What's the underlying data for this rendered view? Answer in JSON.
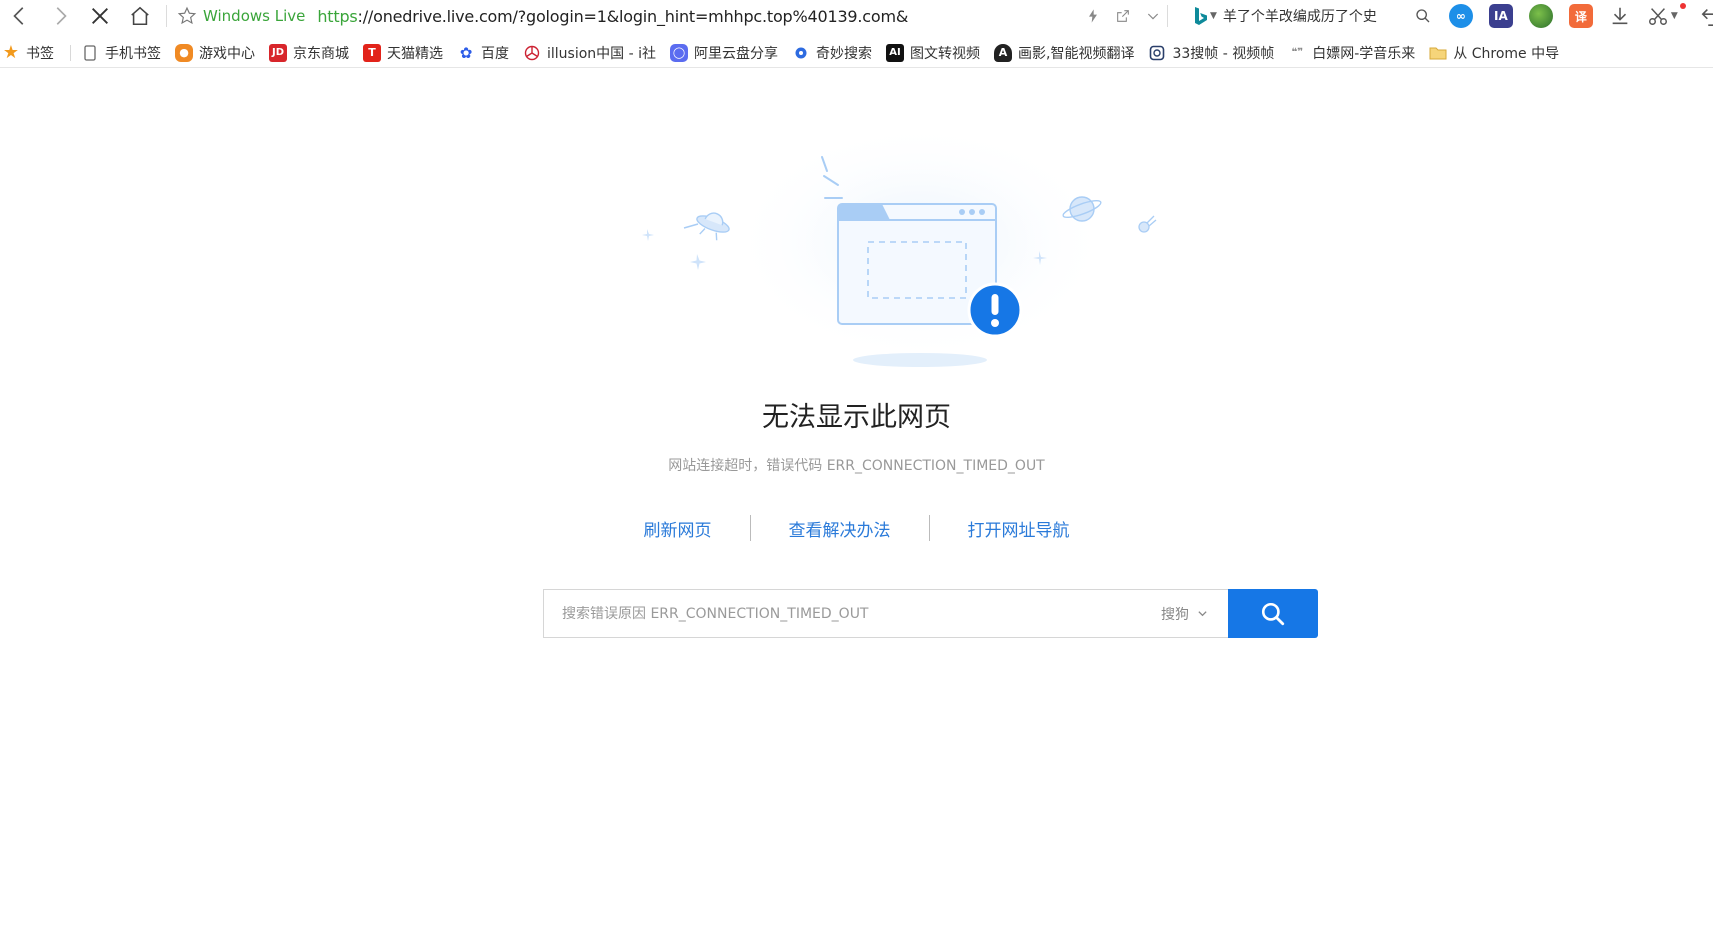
{
  "toolbar": {
    "site_name": "Windows Live",
    "url_protocol": "https",
    "url_rest": "://onedrive.live.com/?gologin=1&login_hint=mhhpc.top%40139.com&",
    "search_query": "羊了个羊改编成历了个史"
  },
  "extension_labels": {
    "ia": "IA",
    "translate": "译"
  },
  "bookmarks": [
    {
      "label": "书签",
      "icon": "star-icon"
    },
    {
      "label": "手机书签",
      "icon": "phone-icon"
    },
    {
      "label": "游戏中心",
      "icon": "gamepad-icon"
    },
    {
      "label": "京东商城",
      "icon": "jd-icon",
      "badge": "JD"
    },
    {
      "label": "天猫精选",
      "icon": "tmall-icon",
      "badge": "T"
    },
    {
      "label": "百度",
      "icon": "baidu-paw-icon"
    },
    {
      "label": "illusion中国 - i社",
      "icon": "illusion-icon"
    },
    {
      "label": "阿里云盘分享",
      "icon": "aliyun-icon"
    },
    {
      "label": "奇妙搜索",
      "icon": "qimiao-icon"
    },
    {
      "label": "图文转视频",
      "icon": "ai-icon",
      "badge": "AI"
    },
    {
      "label": "画影,智能视频翻译",
      "icon": "huaying-icon",
      "badge": "A"
    },
    {
      "label": "33搜帧 - 视频帧",
      "icon": "33-icon"
    },
    {
      "label": "白嫖网-学音乐来",
      "icon": "baipiao-icon"
    },
    {
      "label": "从 Chrome 中导",
      "icon": "folder-icon"
    }
  ],
  "error": {
    "title": "无法显示此网页",
    "description": "网站连接超时，错误代码 ERR_CONNECTION_TIMED_OUT",
    "actions": {
      "refresh": "刷新网页",
      "solutions": "查看解决办法",
      "navigation": "打开网址导航"
    },
    "search": {
      "placeholder": "搜索错误原因 ERR_CONNECTION_TIMED_OUT",
      "engine": "搜狗"
    }
  },
  "colors": {
    "accent_blue": "#1677e6",
    "link_blue": "#2a7ad9",
    "site_green": "#3aa53a",
    "illustration_blue": "#a9cdf5"
  }
}
